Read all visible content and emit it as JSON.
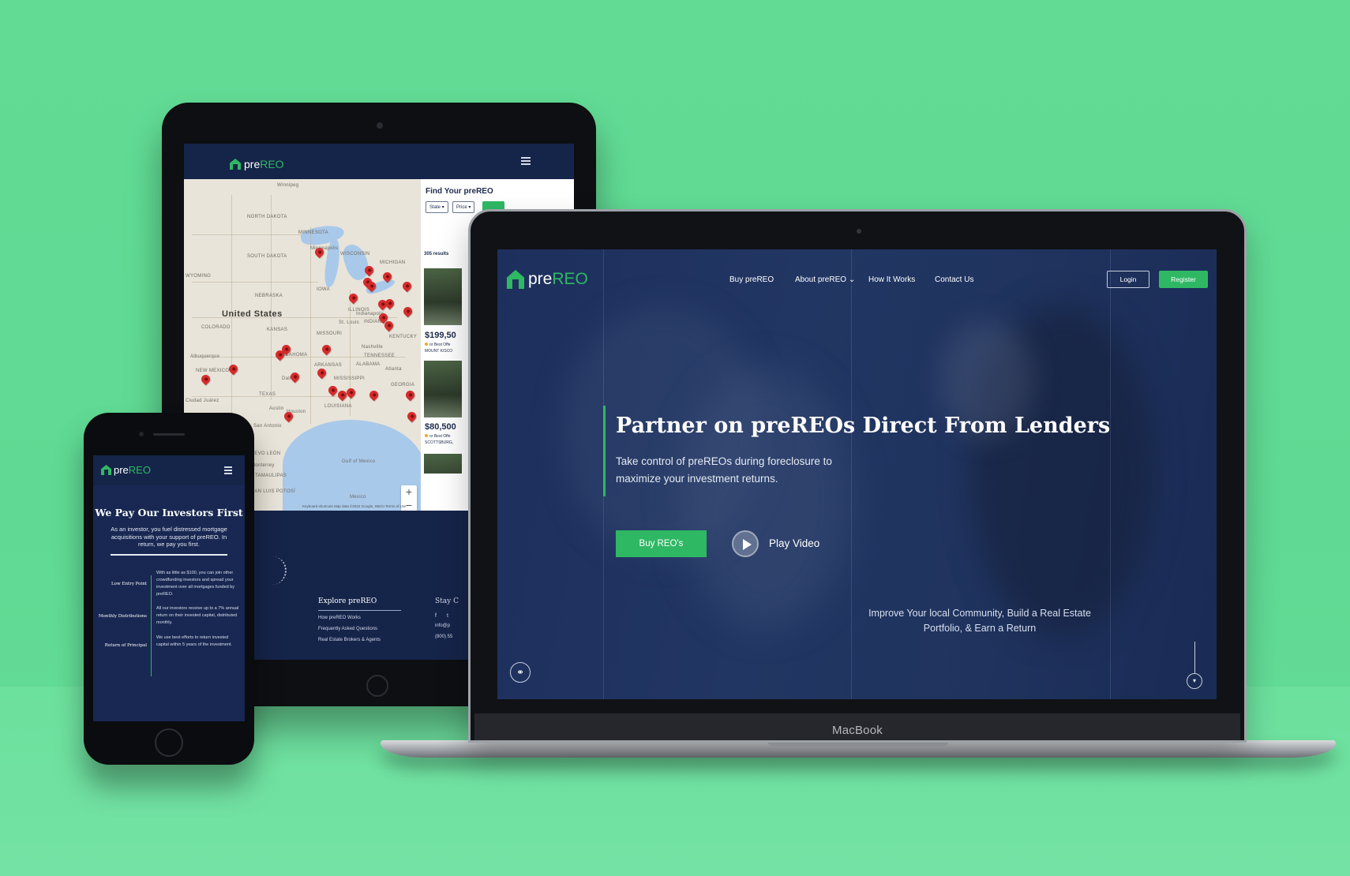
{
  "brand": {
    "logo_prefix": "pre",
    "logo_suffix": "REO",
    "accent_color": "#2fb864",
    "navy_color": "#182852",
    "background_color": "#62dc95"
  },
  "laptop": {
    "device_label": "MacBook",
    "nav": {
      "items": [
        {
          "label": "Buy preREO"
        },
        {
          "label": "About preREO ⌄"
        },
        {
          "label": "How It Works"
        },
        {
          "label": "Contact Us"
        }
      ],
      "login_label": "Login",
      "register_label": "Register"
    },
    "hero": {
      "headline": "Partner on preREOs Direct From Lenders",
      "subtext": "Take control of preREOs during foreclosure to maximize your investment returns.",
      "cta_label": "Buy REO's",
      "play_label": "Play Video",
      "tagline": "Improve Your local Community, Build a Real Estate Portfolio, & Earn a Return"
    },
    "icons": {
      "share": "share-icon",
      "scroll_down": "chevron-down-icon",
      "play": "play-icon"
    }
  },
  "tablet": {
    "search": {
      "title": "Find Your preREO",
      "state_label": "State ▾",
      "price_label": "Price ▾",
      "results_label": "305 results"
    },
    "map": {
      "country_label": "United States",
      "place_labels": [
        "Winnipeg",
        "NORTH DAKOTA",
        "MINNESOTA",
        "Minneapolis",
        "WISCONSIN",
        "MICHIGAN",
        "SOUTH DAKOTA",
        "WYOMING",
        "NEBRASKA",
        "IOWA",
        "ILLINOIS",
        "INDIANA",
        "COLORADO",
        "KANSAS",
        "MISSOURI",
        "St. Louis",
        "Indianapolis",
        "KENTUCKY",
        "Nashville",
        "TENNESSEE",
        "OKLAHOMA",
        "ARKANSAS",
        "Albuquerque",
        "NEW MEXICO",
        "MISSISSIPPI",
        "ALABAMA",
        "Atlanta",
        "GEORGIA",
        "TEXAS",
        "Dallas",
        "LOUISIANA",
        "Austin",
        "Houston",
        "San Antonio",
        "Ciudad Juárez",
        "NUEVO LEÓN",
        "Monterrey",
        "TAMAULIPAS",
        "SAN LUIS POTOSÍ",
        "Gulf of Mexico",
        "Mexico"
      ],
      "footer": "Keyboard shortcuts   Map data ©2022 Google, INEGI   Terms of Use",
      "zoom_in": "+",
      "zoom_out": "−"
    },
    "listings": [
      {
        "price": "$199,50",
        "note": "or Best Offe",
        "city": "MOUNT KISCO"
      },
      {
        "price": "$80,500",
        "note": "or Best Offe",
        "city": "SCOTTSBURG,"
      }
    ],
    "footer": {
      "explore_heading": "Explore preREO",
      "links": [
        "How preREO Works",
        "Frequently Asked Questions",
        "Real Estate Brokers & Agents"
      ],
      "stay_heading": "Stay C",
      "contact_email_fragment": "info@p",
      "contact_phone_fragment": "(800) 55",
      "social_icons": [
        "f",
        "t"
      ]
    }
  },
  "phone": {
    "title": "We Pay Our Investors First",
    "subtitle": "As an investor, you fuel distressed mortgage acquisitions with your support of preREO. In return, we pay you first.",
    "features": [
      {
        "label": "Low Entry Point",
        "description": "With as little as $100, you can join other crowdfunding investors and spread your investment over all mortgages funded by preREO."
      },
      {
        "label": "Monthly Distributions",
        "description": "All our investors receive up to a 7% annual return on their invested capital, distributed monthly."
      },
      {
        "label": "Return of Principal",
        "description": "We use best efforts to return invested capital within 5 years of the investment."
      }
    ]
  }
}
